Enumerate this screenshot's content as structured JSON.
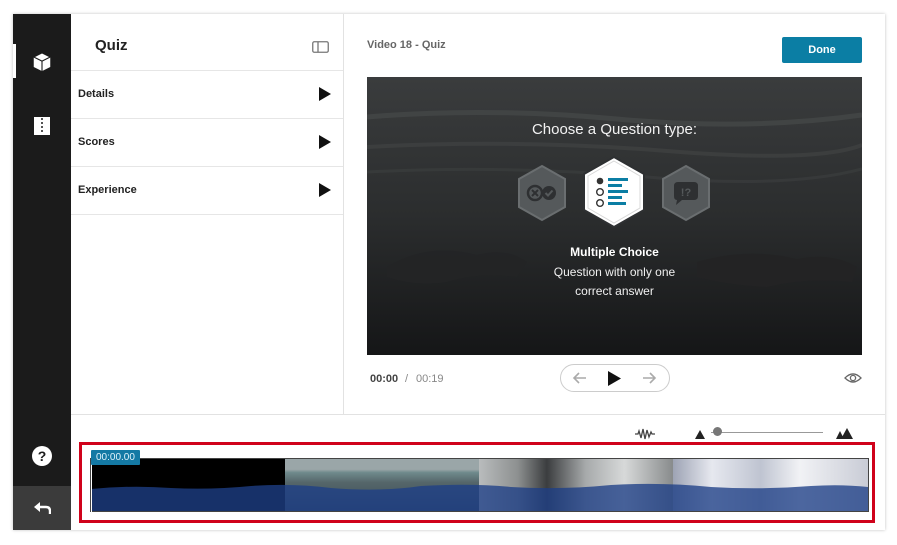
{
  "sidebar": {
    "items": [
      {
        "icon": "cube-icon",
        "active": true
      },
      {
        "icon": "document-icon",
        "active": false
      }
    ],
    "help_icon": "question-circle-icon",
    "undo_icon": "undo-arrow-icon"
  },
  "panel": {
    "title": "Quiz",
    "toggle_icon": "panel-toggle-icon",
    "sections": [
      {
        "label": "Details"
      },
      {
        "label": "Scores"
      },
      {
        "label": "Experience"
      }
    ]
  },
  "editor": {
    "video_title": "Video 18 - Quiz",
    "done_label": "Done",
    "question_prompt": "Choose a Question type:",
    "question_types": [
      {
        "icon": "true-false-icon",
        "selected": false
      },
      {
        "icon": "multiple-choice-icon",
        "selected": true
      },
      {
        "icon": "open-question-icon",
        "selected": false
      }
    ],
    "selected_type_name": "Multiple Choice",
    "selected_type_desc": "Question with only one correct answer"
  },
  "player": {
    "current_time": "00:00",
    "separator": "/",
    "total_time": "00:19",
    "buttons": [
      "arrow-left-icon",
      "play-icon",
      "arrow-right-icon"
    ],
    "preview_icon": "eye-icon"
  },
  "timeline": {
    "current_time_chip": "00:00.00",
    "zoom_level": 0.02,
    "tools": [
      "waveform-icon",
      "zoom-out-icon",
      "zoom-in-icon"
    ]
  },
  "colors": {
    "accent": "#0b7ea4",
    "rail": "#1b1b1b",
    "highlight": "#d0021b"
  }
}
